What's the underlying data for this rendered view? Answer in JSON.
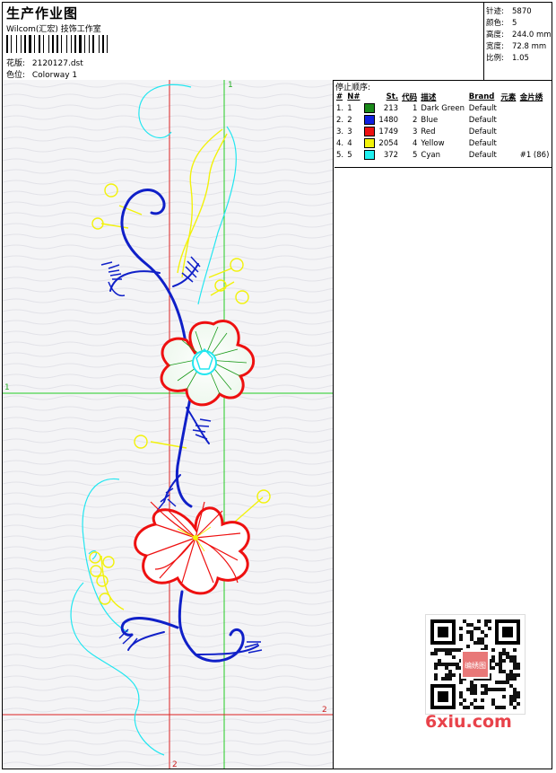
{
  "header": {
    "title": "生产作业图",
    "subtitle": "Wilcom(汇宏) 技饰工作室",
    "design_label": "花版:",
    "design_value": "2120127.dst",
    "colorway_label": "色位:",
    "colorway_value": "Colorway 1"
  },
  "stats": [
    {
      "label": "针迹:",
      "value": "5870"
    },
    {
      "label": "颜色:",
      "value": "5"
    },
    {
      "label": "高度:",
      "value": "244.0 mm"
    },
    {
      "label": "宽度:",
      "value": "72.8 mm"
    },
    {
      "label": "比例:",
      "value": "1.05"
    }
  ],
  "sequence": {
    "title": "停止顺序:",
    "columns": [
      "#",
      "N#",
      "St.",
      "代码",
      "描述",
      "Brand",
      "元素",
      "金片绣"
    ],
    "rows": [
      {
        "num": "1.",
        "n": "1",
        "color": "#1a8a1a",
        "st": "213",
        "code": "1",
        "desc": "Dark Green",
        "brand": "Default",
        "element": "",
        "sequin": ""
      },
      {
        "num": "2.",
        "n": "2",
        "color": "#1020e0",
        "st": "1480",
        "code": "2",
        "desc": "Blue",
        "brand": "Default",
        "element": "",
        "sequin": ""
      },
      {
        "num": "3.",
        "n": "3",
        "color": "#ee1010",
        "st": "1749",
        "code": "3",
        "desc": "Red",
        "brand": "Default",
        "element": "",
        "sequin": ""
      },
      {
        "num": "4.",
        "n": "4",
        "color": "#f2f20a",
        "st": "2054",
        "code": "4",
        "desc": "Yellow",
        "brand": "Default",
        "element": "",
        "sequin": ""
      },
      {
        "num": "5.",
        "n": "5",
        "color": "#20f0f0",
        "st": "372",
        "code": "5",
        "desc": "Cyan",
        "brand": "Default",
        "element": "",
        "sequin": "#1 (86)"
      }
    ]
  },
  "guides": {
    "h1": "1",
    "v1": "1",
    "h2": "2",
    "v2": "2"
  },
  "watermark": {
    "text": "6xiu.com",
    "qr_stamp": "编绣图"
  }
}
